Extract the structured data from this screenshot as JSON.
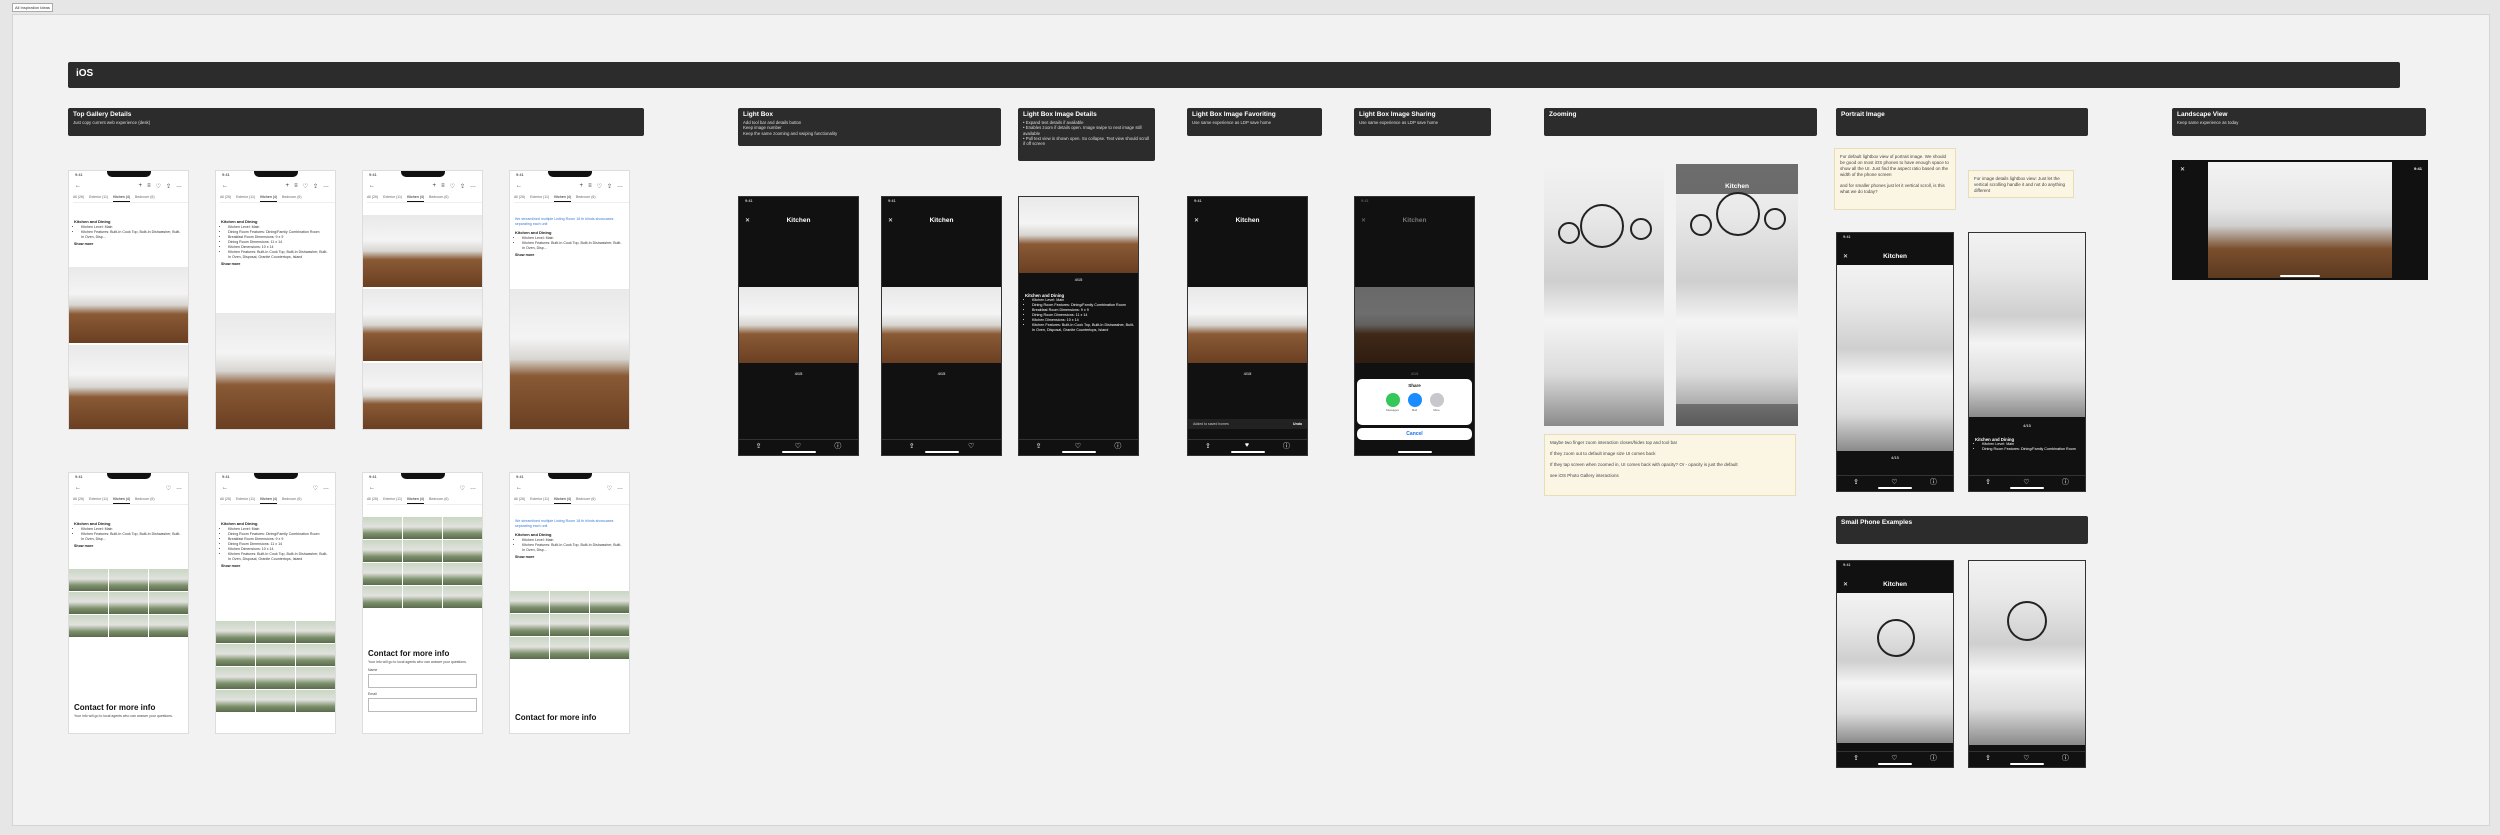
{
  "canvas_label": "All Inspiration Ideas",
  "ios_title": "iOS",
  "sections": {
    "top_gallery": {
      "title": "Top Gallery Details",
      "desc": "Just copy current web experience (desk)"
    },
    "light_box": {
      "title": "Light Box",
      "desc": "Add tool bar and details button\nKeep image number\nKeep the same zooming and swiping functionality"
    },
    "lb_details": {
      "title": "Light Box Image Details",
      "desc": "• Expand text details if available\n• Enables zoom if details open. Image swipe to next image still available\n• Pull text view is shown open. So collapse. Text view should scroll if off screen"
    },
    "lb_fav": {
      "title": "Light Box Image Favoriting",
      "desc": "Use same experience as LDP save home"
    },
    "lb_share": {
      "title": "Light Box Image Sharing",
      "desc": "Use same experience as LDP save home"
    },
    "zooming": {
      "title": "Zooming",
      "desc": ""
    },
    "portrait": {
      "title": "Portrait Image",
      "desc": ""
    },
    "landscape": {
      "title": "Landscape View",
      "desc": "Keep same experience as today"
    },
    "small_phone": {
      "title": "Small Phone Examples",
      "desc": ""
    }
  },
  "phone": {
    "time": "9:41",
    "signal": "▮▮ ◠ ▬",
    "back_icon": "←",
    "nav_icons": [
      "+",
      "≡",
      "♡",
      "⇪",
      "…"
    ],
    "tabs": [
      "All (26)",
      "Exterior (11)",
      "Kitchen (4)",
      "Bedroom (6)"
    ],
    "details_heading": "Kitchen and Dining",
    "details_items": [
      "Kitchen Level: Main",
      "Kitchen Features: Built-In Cook Top, Built-In Dishwasher, Built-In Oven, Disp...",
      "Dining Room Features: Dining/Family Combination Room",
      "Breakfast Room Dimensions: 9 x 9",
      "Dining Room Dimensions: 11 x 14",
      "Kitchen Dimensions: 10 x 14",
      "Kitchen Features: Built-In Cook Top, Built-In Dishwasher, Built-In Oven, Disposal, Granite Countertops, Island"
    ],
    "show_more": "Show more",
    "disclaimer": "We streamlined multiple Listing Room 18 th blinds showcases separating each unit",
    "contact_title": "Contact for more info",
    "contact_sub": "Your info will go to local agents who can answer your questions.",
    "name_label": "Name",
    "email_label": "Email"
  },
  "lightbox": {
    "title": "Kitchen",
    "close_icon": "✕",
    "more_icon": "⋯",
    "count": "4/15",
    "count_share": "4/15",
    "share_icon": "⇪",
    "heart_icon": "♡",
    "heart_filled_icon": "♥",
    "info_icon": "ⓘ",
    "added_text": "Added to saved homes",
    "undo_text": "Undo",
    "share_title": "Share",
    "share_apps": [
      "Messages",
      "Mail",
      "More"
    ],
    "cancel_label": "Cancel"
  },
  "notes": {
    "zoom": [
      "Maybe two finger zoom interaction closes/hides top and tool bar",
      "If they zoom out to default image size UI comes back",
      "If they tap screen when zoomed in, UI comes back with opacity? Or - opacity is just the default",
      "see iOS Photo Gallery interactions"
    ],
    "portrait_1": [
      "For default lightbox view of portrait image. We should be good on most iOS phones to have enough space to show all the UI. Just find the aspect ratio based on the width of the phone screen",
      "and for smaller phones just let it vertical scroll, is this what we do today?"
    ],
    "portrait_2": [
      "For image details lightbox view: Just let the vertical scrolling handle it and not do anything different"
    ]
  },
  "colors": {
    "dark_bar": "#2c2c2c",
    "note_bg": "#fbf5e4",
    "link_blue": "#3a7bd5",
    "share_green": "#34c759",
    "share_blue": "#1a8cff",
    "share_gray": "#c7c7cc"
  }
}
